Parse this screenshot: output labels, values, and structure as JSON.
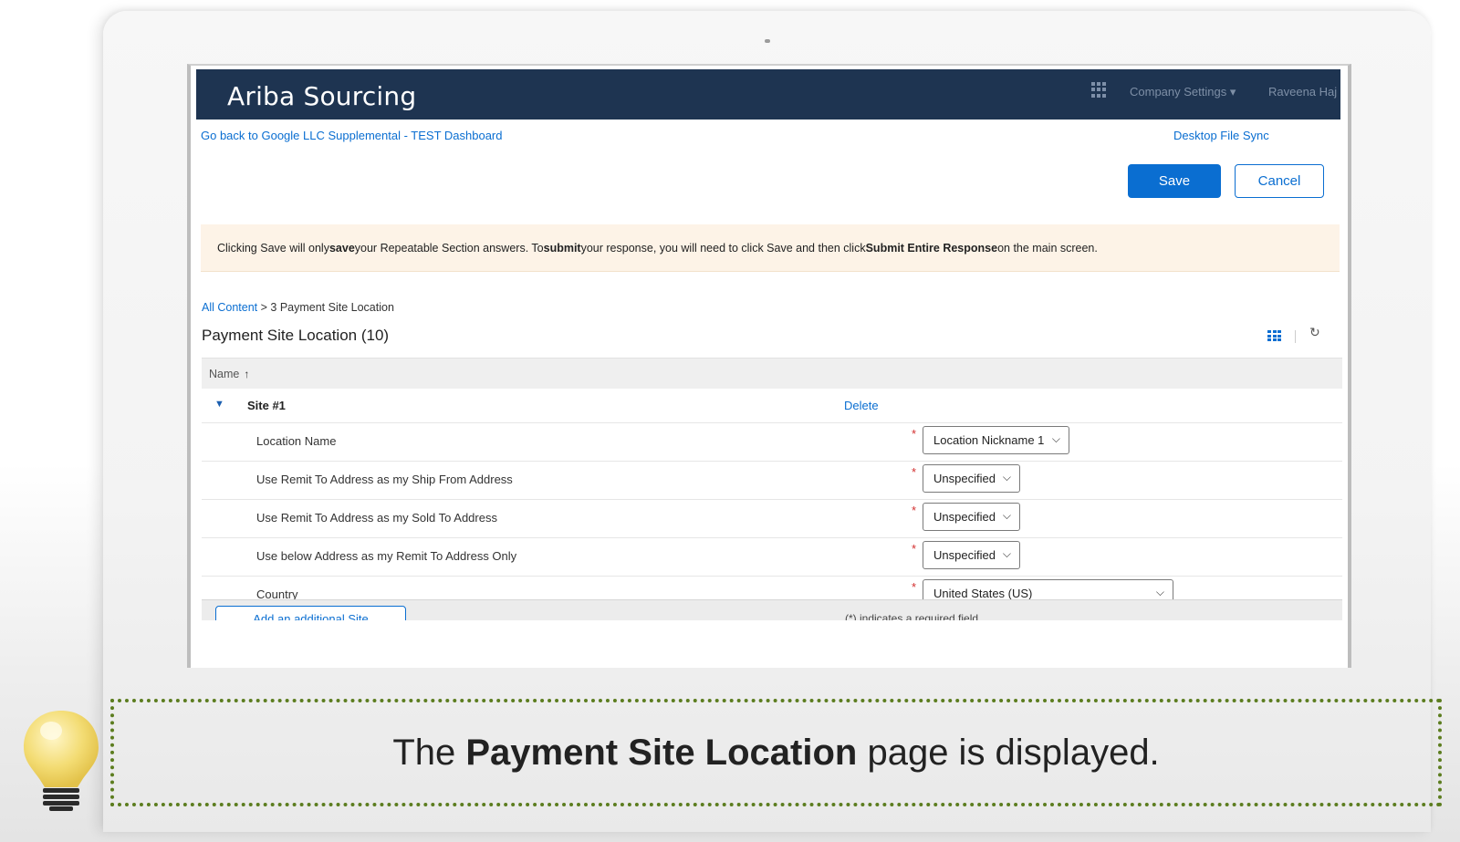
{
  "app": {
    "title": "Ariba Sourcing",
    "company_settings": "Company Settings ▾",
    "user_name": "Raveena Haj"
  },
  "links": {
    "back": "Go back to Google LLC Supplemental - TEST Dashboard",
    "desktop_sync": "Desktop File Sync"
  },
  "actions": {
    "save": "Save",
    "cancel": "Cancel"
  },
  "notice": {
    "p1": "Clicking Save will only ",
    "b1": "save",
    "p2": " your Repeatable Section answers. To ",
    "b2": "submit",
    "p3": " your response, you will need to click Save and then click ",
    "b3": "Submit Entire Response",
    "p4": " on the main screen."
  },
  "breadcrumb": {
    "link": "All Content",
    "sep": " > ",
    "current": "3 Payment Site Location"
  },
  "page": {
    "title": "Payment Site Location (10)"
  },
  "table": {
    "column_name": "Name",
    "site_label": "Site #1",
    "delete": "Delete",
    "fields": [
      {
        "label": "Location Name",
        "value": "Location Nickname 1"
      },
      {
        "label": "Use Remit To Address as my Ship From Address",
        "value": "Unspecified"
      },
      {
        "label": "Use Remit To Address as my Sold To Address",
        "value": "Unspecified"
      },
      {
        "label": "Use below Address as my Remit To Address Only",
        "value": "Unspecified"
      },
      {
        "label": "Country",
        "value": "United States (US)"
      }
    ],
    "required_mark": "*"
  },
  "footer": {
    "add_site": "Add an additional Site",
    "required_note": "(*) indicates a required field"
  },
  "caption": {
    "pre": "The ",
    "bold": "Payment Site Location",
    "post": " page is displayed."
  },
  "colors": {
    "header_bg": "#1e3451",
    "accent": "#0a6ed1",
    "notice_bg": "#fdf3e7",
    "caption_border": "#5c7d1f"
  }
}
